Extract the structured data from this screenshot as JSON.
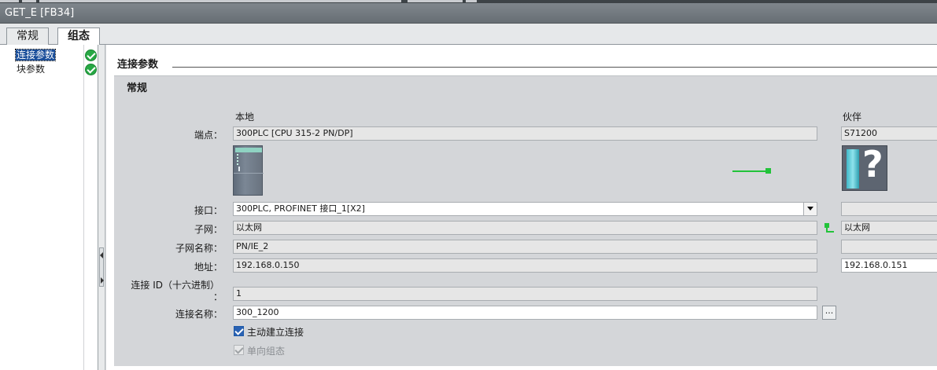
{
  "window": {
    "title": "GET_E [FB34]"
  },
  "tabs": [
    {
      "label": "常规",
      "active": false
    },
    {
      "label": "组态",
      "active": true
    }
  ],
  "tree": {
    "items": [
      {
        "label": "连接参数",
        "selected": true,
        "status_icon": "check-circle-icon"
      },
      {
        "label": "块参数",
        "selected": false,
        "status_icon": "check-circle-icon"
      }
    ]
  },
  "section": {
    "title": "连接参数"
  },
  "group": {
    "title": "常规"
  },
  "columns": {
    "local": "本地",
    "partner": "伙伴"
  },
  "labels": {
    "endpoint": "端点：",
    "interface": "接口：",
    "subnet": "子网：",
    "subnet_name": "子网名称：",
    "address": "地址：",
    "connection_id": "连接 ID（十六进制）",
    "connection_id_colon": "：",
    "connection_name": "连接名称："
  },
  "local": {
    "endpoint": "300PLC [CPU 315-2 PN/DP]",
    "interface": "300PLC, PROFINET 接口_1[X2]",
    "subnet": "以太网",
    "subnet_name": "PN/IE_2",
    "address": "192.168.0.150",
    "connection_id": "1",
    "connection_name": "300_1200",
    "device_icon": "cpu-module-icon"
  },
  "partner": {
    "endpoint": "S71200",
    "interface": "",
    "subnet": "以太网",
    "subnet_name": "",
    "address": "192.168.0.151",
    "device_icon": "unknown-device-icon"
  },
  "buttons": {
    "ellipsis": "..."
  },
  "options": {
    "active_connection": {
      "label": "主动建立连接",
      "checked": true,
      "enabled": true
    },
    "one_way": {
      "label": "单向组态",
      "checked": true,
      "enabled": false
    }
  },
  "colors": {
    "accent": "#2a62b3",
    "status_ok": "#27a844",
    "link": "#22c33a"
  }
}
